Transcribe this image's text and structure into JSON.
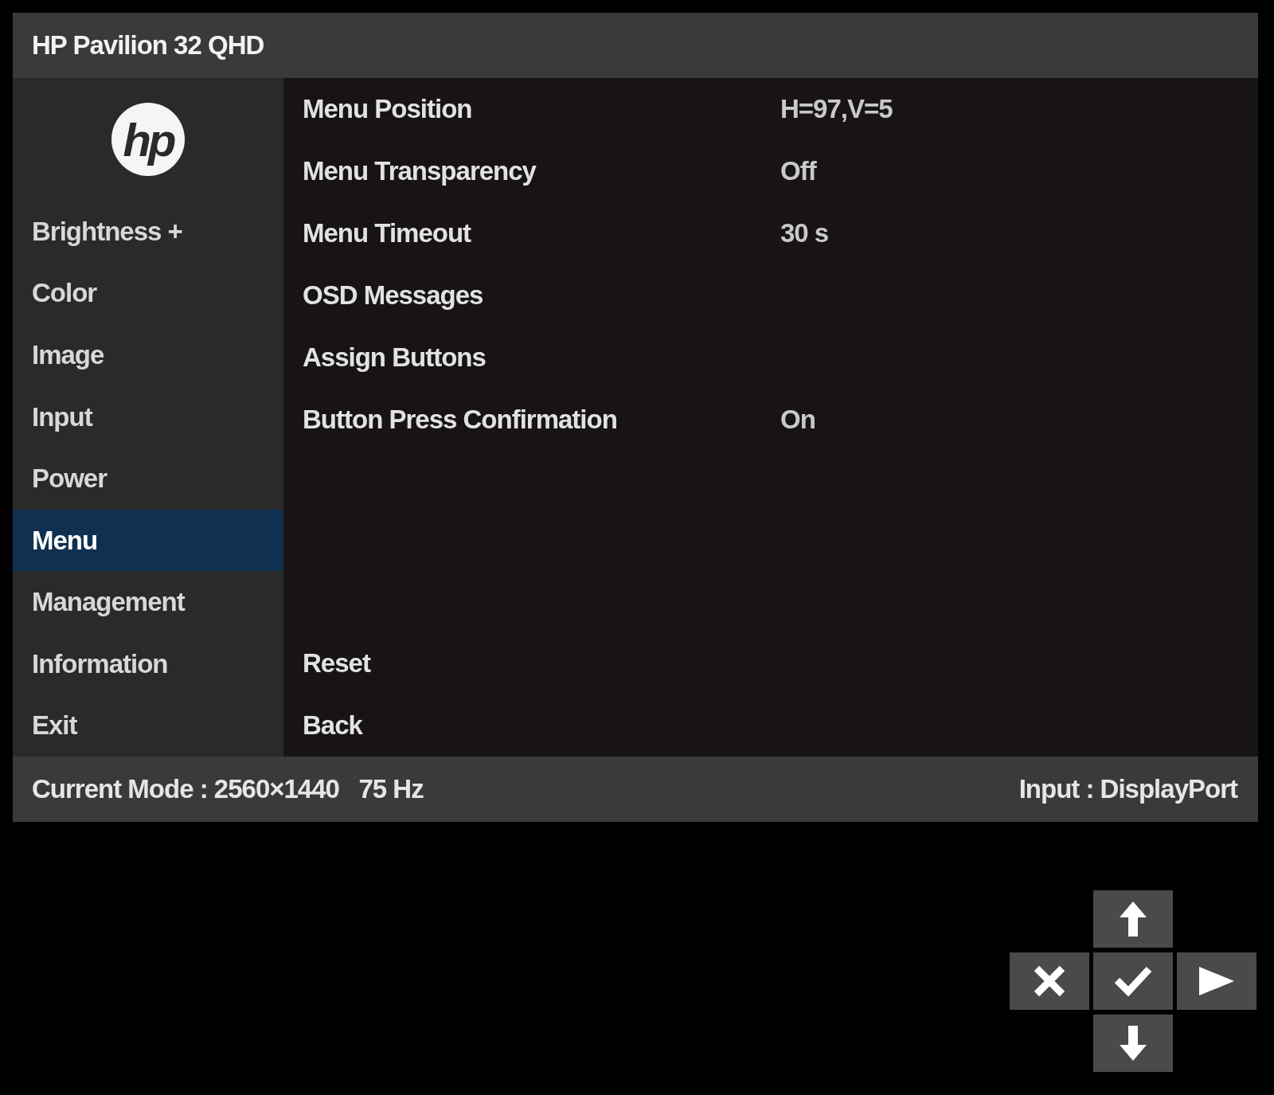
{
  "window": {
    "title": "HP Pavilion 32 QHD"
  },
  "logo": "hp",
  "sidebar": {
    "items": [
      {
        "label": "Brightness +",
        "selected": false
      },
      {
        "label": "Color",
        "selected": false
      },
      {
        "label": "Image",
        "selected": false
      },
      {
        "label": "Input",
        "selected": false
      },
      {
        "label": "Power",
        "selected": false
      },
      {
        "label": "Menu",
        "selected": true
      },
      {
        "label": "Management",
        "selected": false
      },
      {
        "label": "Information",
        "selected": false
      },
      {
        "label": "Exit",
        "selected": false
      }
    ]
  },
  "settings": [
    {
      "label": "Menu Position",
      "value": "H=97,V=5"
    },
    {
      "label": "Menu Transparency",
      "value": "Off"
    },
    {
      "label": "Menu Timeout",
      "value": "30 s"
    },
    {
      "label": "OSD Messages"
    },
    {
      "label": "Assign Buttons"
    },
    {
      "label": "Button Press Confirmation",
      "value": "On"
    }
  ],
  "actions": [
    "Reset",
    "Back"
  ],
  "status_bar": {
    "mode": "Current Mode : 2560×1440   75 Hz",
    "input": "Input : DisplayPort"
  },
  "keypad": [
    {
      "kind": "up"
    },
    {
      "kind": "cancel"
    },
    {
      "kind": "ok"
    },
    {
      "kind": "right"
    },
    {
      "kind": "down"
    }
  ]
}
